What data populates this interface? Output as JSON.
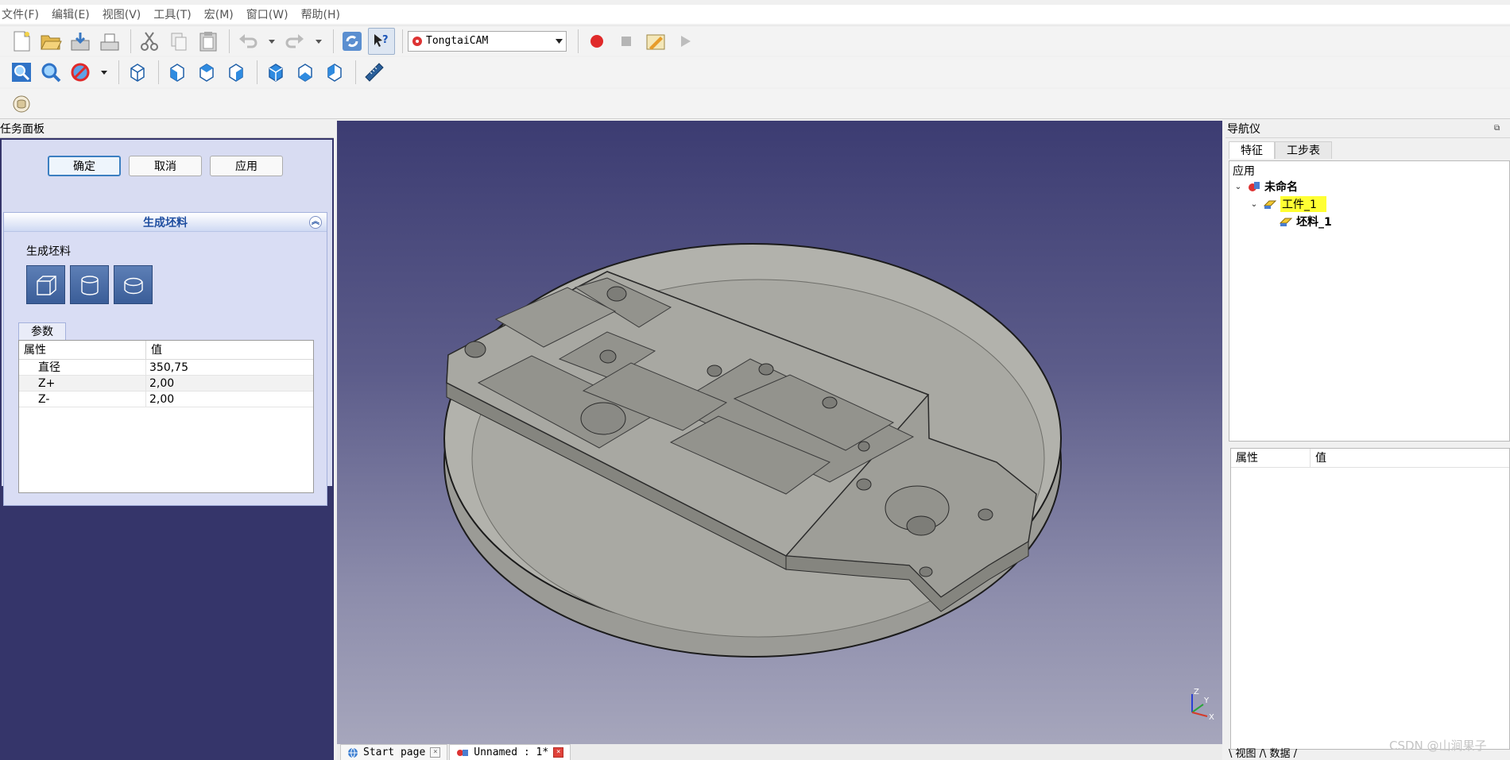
{
  "menu": [
    "文件(F)",
    "编辑(E)",
    "视图(V)",
    "工具(T)",
    "宏(M)",
    "窗口(W)",
    "帮助(H)"
  ],
  "toolbar": {
    "workbench_selected": "TongtaiCAM",
    "icons_row1": [
      "new-file-icon",
      "open-icon",
      "save-icon",
      "save-as-icon",
      "cut-icon",
      "copy-icon",
      "paste-icon",
      "undo-icon",
      "redo-icon",
      "refresh-icon",
      "whats-this-icon",
      "record-macro-icon",
      "stop-macro-icon",
      "edit-macro-icon",
      "run-macro-icon"
    ],
    "icons_row2": [
      "fit-all-icon",
      "fit-selection-icon",
      "draw-style-icon",
      "isometric-view-icon",
      "front-view-icon",
      "top-view-icon",
      "right-view-icon",
      "rear-view-icon",
      "bottom-view-icon",
      "left-view-icon",
      "measure-icon"
    ],
    "icons_row3": [
      "part-icon"
    ]
  },
  "task_panel": {
    "title": "任务面板",
    "buttons": {
      "ok": "确定",
      "cancel": "取消",
      "apply": "应用"
    },
    "group_title": "生成坯料",
    "section_label": "生成坯料",
    "stock_shapes": [
      "box-stock-icon",
      "cylinder-stock-icon",
      "extrusion-stock-icon"
    ],
    "params_tab": "参数",
    "table": {
      "headers": [
        "属性",
        "值"
      ],
      "rows": [
        {
          "name": "直径",
          "value": "350,75"
        },
        {
          "name": "Z+",
          "value": "2,00"
        },
        {
          "name": "Z-",
          "value": "2,00"
        }
      ]
    }
  },
  "viewport": {
    "axis": {
      "z": "Z",
      "y": "Y",
      "x": "X"
    }
  },
  "doc_tabs": [
    {
      "label": "Start page"
    },
    {
      "label": "Unnamed : 1*"
    }
  ],
  "navigator": {
    "title": "导航仪",
    "tabs": [
      "特征",
      "工步表"
    ],
    "tree_root": "应用",
    "nodes": {
      "document": "未命名",
      "workpiece": "工件_1",
      "stock": "坯料_1"
    },
    "prop_headers": [
      "属性",
      "值"
    ],
    "bottom_tabs": "\\ 视图 /\\ 数据 /"
  },
  "watermark": "CSDN @山涧果子",
  "colors": {
    "viewport_top": "#3c3c72",
    "viewport_bottom": "#a6a6bc",
    "highlight": "#ffff33",
    "panel_bg": "#d8dcf2",
    "part_gray": "#a9a9a3"
  }
}
